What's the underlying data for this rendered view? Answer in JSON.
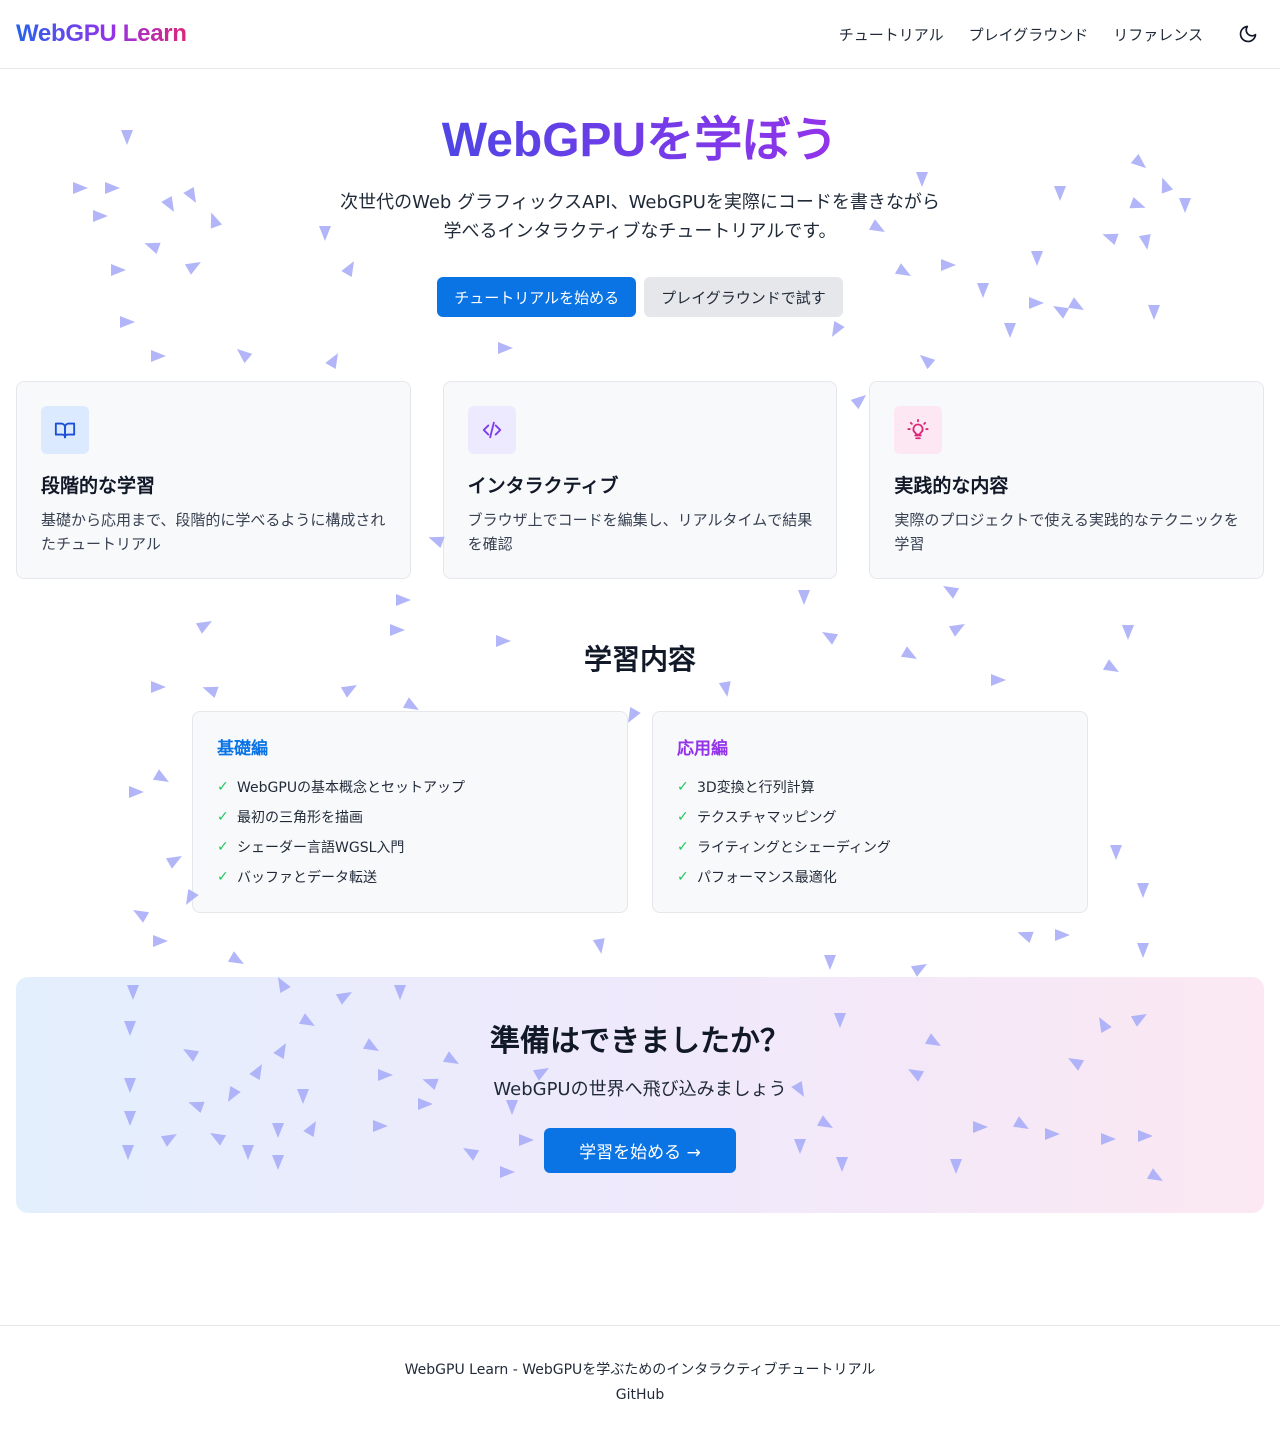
{
  "header": {
    "logo": "WebGPU Learn",
    "nav": [
      "チュートリアル",
      "プレイグラウンド",
      "リファレンス"
    ],
    "theme_icon": "moon-icon"
  },
  "hero": {
    "title": "WebGPUを学ぼう",
    "subtitle_line1": "次世代のWeb グラフィックスAPI、WebGPUを実際にコードを書きながら",
    "subtitle_line2": "学べるインタラクティブなチュートリアルです。",
    "primary_button": "チュートリアルを始める",
    "secondary_button": "プレイグラウンドで試す"
  },
  "features": [
    {
      "icon": "book-icon",
      "title": "段階的な学習",
      "description": "基礎から応用まで、段階的に学べるように構成されたチュートリアル",
      "icon_bg": "#dbeafe",
      "icon_color": "#1d4ed8"
    },
    {
      "icon": "code-icon",
      "title": "インタラクティブ",
      "description": "ブラウザ上でコードを編集し、リアルタイムで結果を確認",
      "icon_bg": "#ede9fe",
      "icon_color": "#7c3aed"
    },
    {
      "icon": "lightbulb-icon",
      "title": "実践的な内容",
      "description": "実際のプロジェクトで使える実践的なテクニックを学習",
      "icon_bg": "#fce7f3",
      "icon_color": "#db2777"
    }
  ],
  "curriculum": {
    "title": "学習内容",
    "basic": {
      "title": "基礎編",
      "color": "#0b74e5",
      "items": [
        "WebGPUの基本概念とセットアップ",
        "最初の三角形を描画",
        "シェーダー言語WGSL入門",
        "バッファとデータ転送"
      ]
    },
    "advanced": {
      "title": "応用編",
      "color": "#9333ea",
      "items": [
        "3D変換と行列計算",
        "テクスチャマッピング",
        "ライティングとシェーディング",
        "パフォーマンス最適化"
      ]
    }
  },
  "cta": {
    "title": "準備はできましたか？",
    "subtitle": "WebGPUの世界へ飛び込みましょう",
    "button": "学習を始める →"
  },
  "footer": {
    "text": "WebGPU Learn - WebGPUを学ぶためのインタラクティブチュートリアル",
    "link": "GitHub"
  },
  "colors": {
    "accent": "#0b74e5",
    "particle": "#a5a9f8"
  }
}
